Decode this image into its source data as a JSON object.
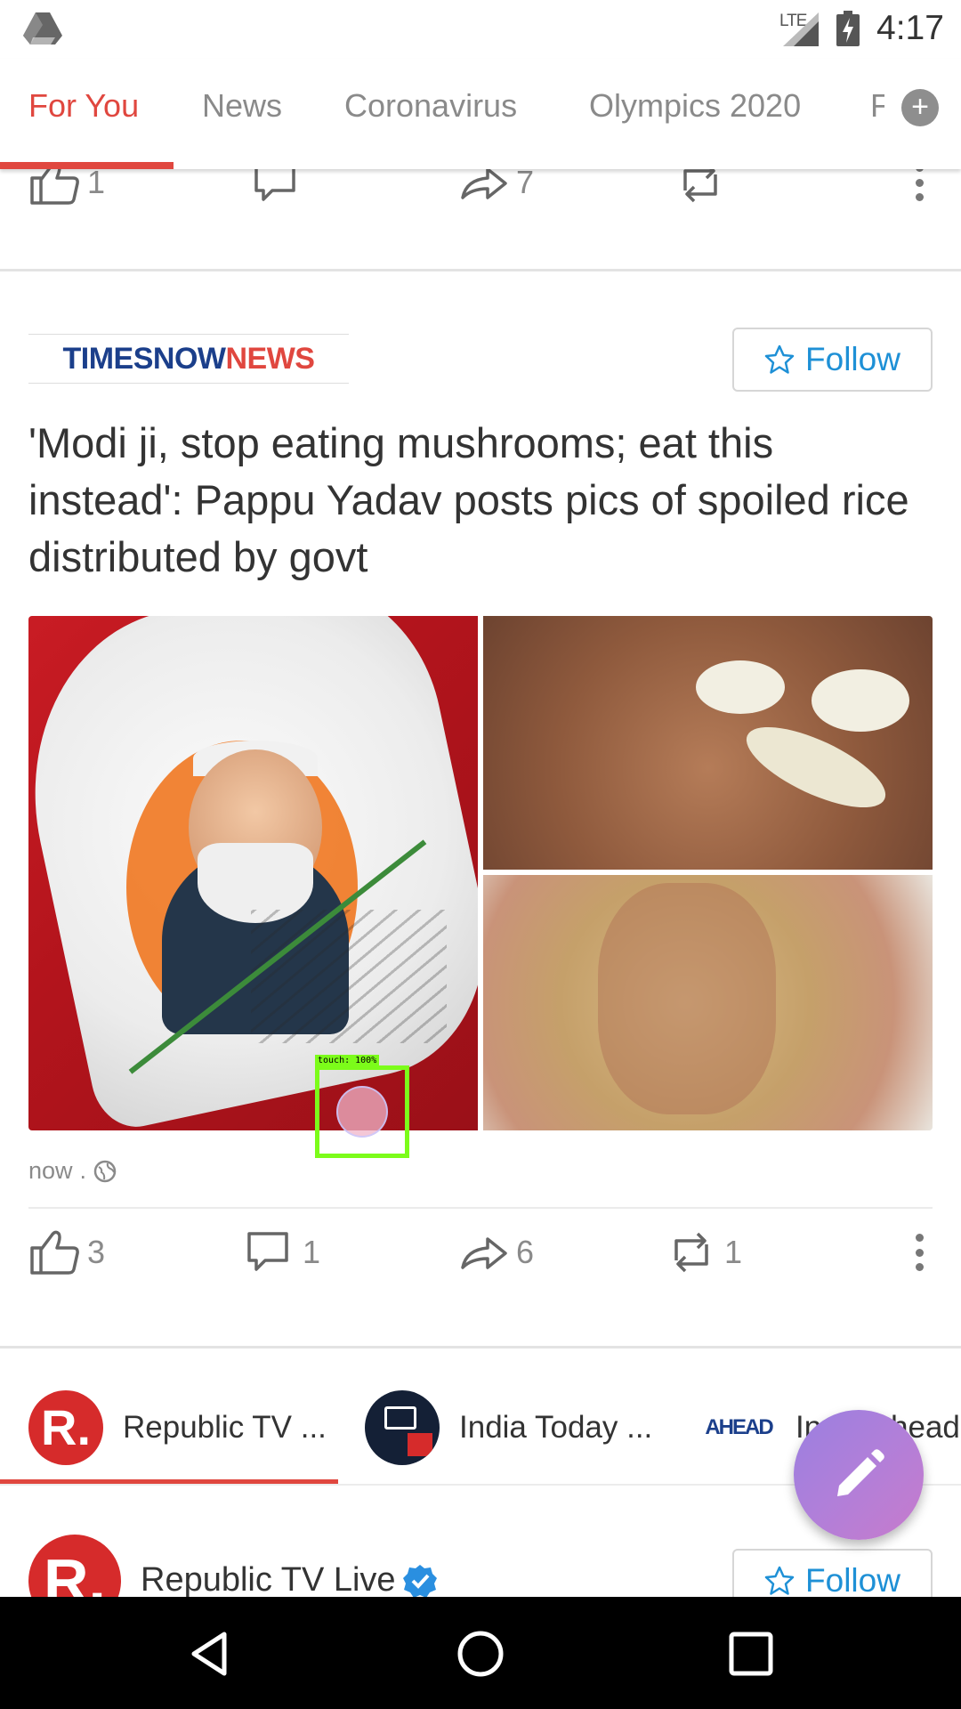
{
  "status_bar": {
    "network": "LTE",
    "time": "4:17",
    "icons": [
      "drive-icon",
      "signal-icon",
      "battery-charging-icon"
    ]
  },
  "tabs": {
    "items": [
      {
        "label": "For You",
        "active": true
      },
      {
        "label": "News",
        "active": false
      },
      {
        "label": "Coronavirus",
        "active": false
      },
      {
        "label": "Olympics 2020",
        "active": false
      },
      {
        "label": "F",
        "active": false
      }
    ],
    "add_icon": "plus-icon"
  },
  "previous_post_actions": {
    "like_count": "1",
    "share_count": "7"
  },
  "post": {
    "source_logo": {
      "part1": "TIMESNOW",
      "part2": "NEWS"
    },
    "follow_label": "Follow",
    "headline": "'Modi ji, stop eating mushrooms; eat this instead': Pappu Yadav posts pics of spoiled rice distributed by govt",
    "touch_label": "touch: 100%",
    "time": "now",
    "separator": ".",
    "privacy_icon": "globe-icon",
    "actions": {
      "like_count": "3",
      "comment_count": "1",
      "share_count": "6",
      "repost_count": "1"
    }
  },
  "channels": [
    {
      "name": "Republic TV ...",
      "avatar_text": "R.",
      "active": true
    },
    {
      "name": "India Today ...",
      "active": false
    },
    {
      "name": "India Ahead",
      "logo_text": "AHEAD",
      "active": false
    }
  ],
  "next_post": {
    "avatar_text": "R.",
    "name": "Republic TV Live",
    "verified": true,
    "follow_label": "Follow"
  },
  "fab": {
    "icon": "pencil-icon"
  },
  "colors": {
    "accent": "#e0473f",
    "follow_blue": "#1e90d6",
    "republic_red": "#d62b2b"
  }
}
